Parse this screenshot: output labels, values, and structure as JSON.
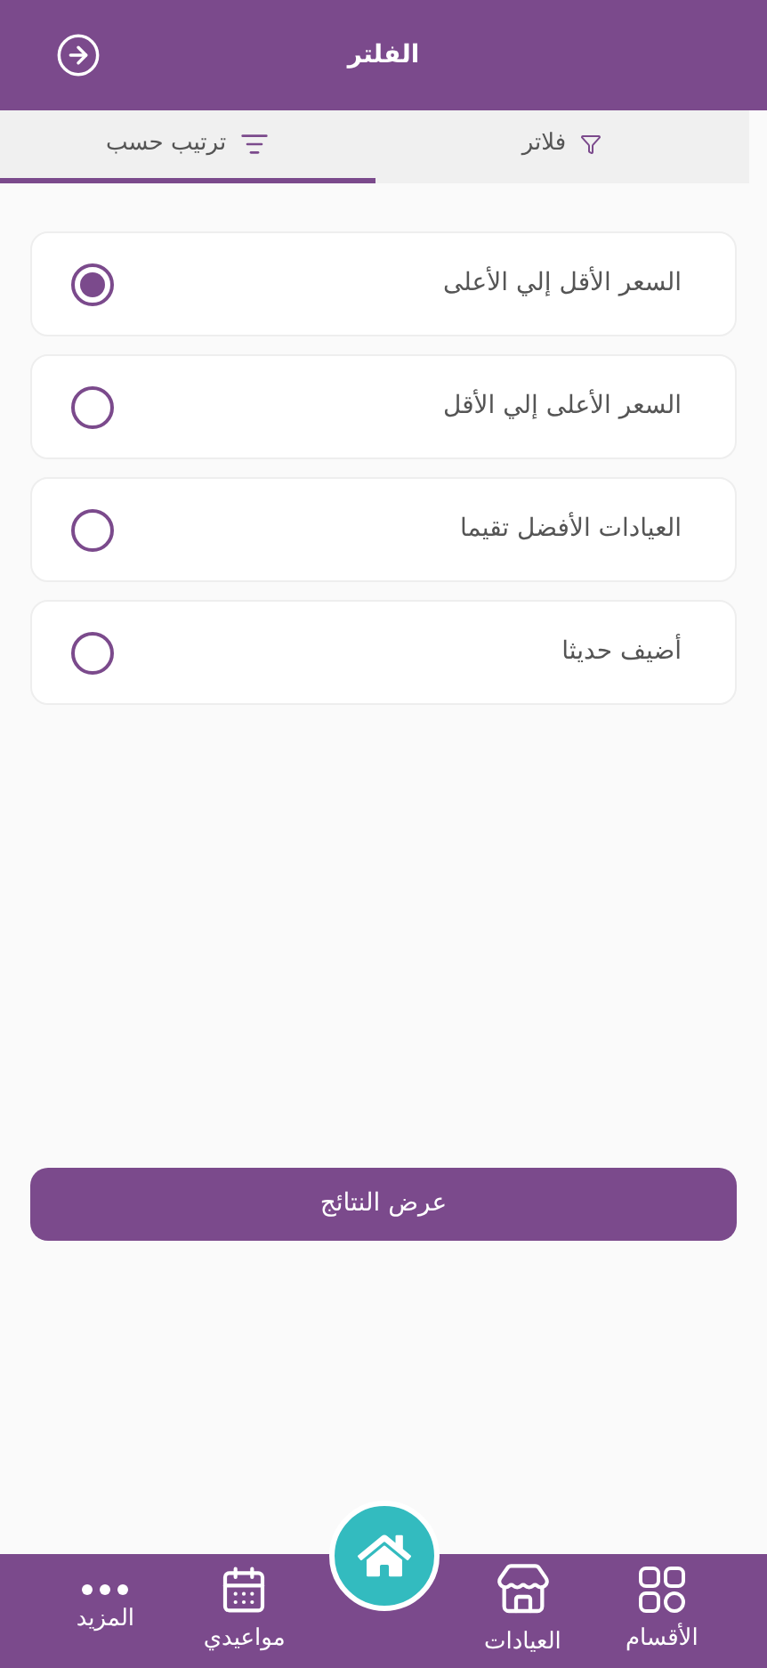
{
  "header": {
    "title": "الفلتر"
  },
  "tabs": [
    {
      "label": "فلاتر",
      "kind": "filter",
      "selected": false
    },
    {
      "label": "ترتيب حسب",
      "kind": "sort",
      "selected": true
    }
  ],
  "sort_options": [
    {
      "label": "السعر الأقل إلي الأعلى",
      "selected": true
    },
    {
      "label": "السعر الأعلى إلي الأقل",
      "selected": false
    },
    {
      "label": "العيادات الأفضل تقيما",
      "selected": false
    },
    {
      "label": "أضيف حديثا",
      "selected": false
    }
  ],
  "apply_button": "عرض النتائج",
  "bottom_nav": [
    {
      "kind": "grid",
      "label": "الأقسام"
    },
    {
      "kind": "store",
      "label": "العيادات"
    },
    {
      "kind": "home"
    },
    {
      "kind": "calendar",
      "label": "مواعيدي"
    },
    {
      "kind": "more",
      "label": "المزيد"
    }
  ]
}
